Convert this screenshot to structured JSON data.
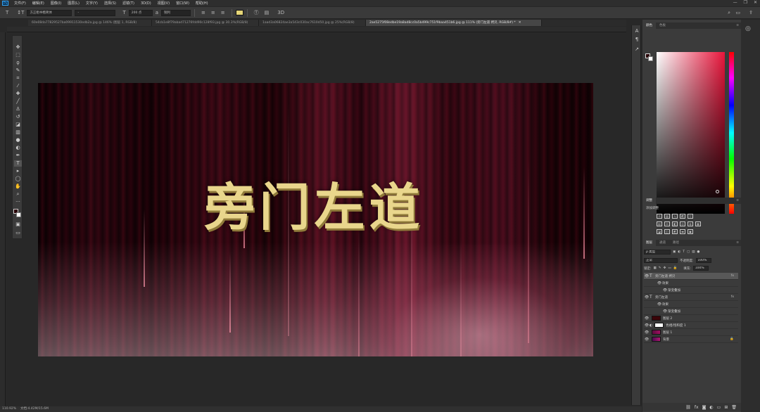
{
  "menubar": {
    "items": [
      "文件(F)",
      "编辑(E)",
      "图像(I)",
      "图层(L)",
      "文字(Y)",
      "选择(S)",
      "滤镜(T)",
      "3D(D)",
      "视图(V)",
      "窗口(W)",
      "帮助(H)"
    ],
    "window_controls": [
      "—",
      "❐",
      "✕"
    ]
  },
  "options": {
    "font_family": "方正粗书楷简体",
    "font_style": "-",
    "font_size": "200 点",
    "aa_label": "锐利",
    "text_color": "#e6d678"
  },
  "tabs": [
    {
      "label": "60e08da77829527ba09911530edb2a.jpg @ 146% (图层 1, RGB/8)",
      "close": "✕",
      "active": false
    },
    {
      "label": "54cb1e8f79abad71276fdd90c128f93.jpg @ 30.3%(RGB/8)",
      "close": "✕",
      "active": false
    },
    {
      "label": "1aad3a06824ae3a543c030ac7610d50.jpg @ 25%(RGB/8)",
      "close": "✕",
      "active": false
    },
    {
      "label": "2ae5275f08edbe19a8ad8cc0a5b499c751f9baa451b6.jpg @ 111% (旁门左道 拷贝, RGB/8#) *",
      "close": "✕",
      "active": true
    }
  ],
  "canvas": {
    "headline": "旁门左道",
    "text_color": "#e9d68c"
  },
  "statusbar": {
    "zoom": "110.92%",
    "doc_info": "文档:4.42M/15.6M"
  },
  "color_panel": {
    "tabs": [
      "颜色",
      "色板"
    ],
    "fg_color": "#2a0408",
    "bg_color": "#ffffff"
  },
  "adjust_panel": {
    "tab": "调整",
    "subtitle": "添加调整"
  },
  "layers_panel": {
    "tabs": [
      "图层",
      "通道",
      "路径"
    ],
    "filter_label": "ρ 类型",
    "blend_mode": "正常",
    "opacity_label": "不透明度:",
    "opacity_value": "100%",
    "lock_label": "锁定:",
    "fill_label": "填充:",
    "fill_value": "100%",
    "layers": [
      {
        "name": "旁门左道 拷贝",
        "kind": "text",
        "selected": true,
        "fx": "fx"
      },
      {
        "name": "效果",
        "kind": "effect",
        "selected": false,
        "fx": ""
      },
      {
        "name": "渐变叠加",
        "kind": "effect-item",
        "selected": false,
        "fx": ""
      },
      {
        "name": "旁门左道",
        "kind": "text",
        "selected": false,
        "fx": "fx"
      },
      {
        "name": "效果",
        "kind": "effect",
        "selected": false,
        "fx": ""
      },
      {
        "name": "渐变叠加",
        "kind": "effect-item",
        "selected": false,
        "fx": ""
      },
      {
        "name": "图层 2",
        "kind": "pixel",
        "selected": false,
        "fx": ""
      },
      {
        "name": "色相/饱和度 1",
        "kind": "adjustment",
        "selected": false,
        "fx": ""
      },
      {
        "name": "图层 1",
        "kind": "pixel",
        "selected": false,
        "fx": ""
      },
      {
        "name": "背景",
        "kind": "background",
        "selected": false,
        "fx": "🔒"
      }
    ],
    "footer_icons": [
      "link-icon",
      "fx-icon",
      "mask-icon",
      "adjust-icon",
      "folder-icon",
      "new-layer-icon",
      "trash-icon"
    ]
  }
}
